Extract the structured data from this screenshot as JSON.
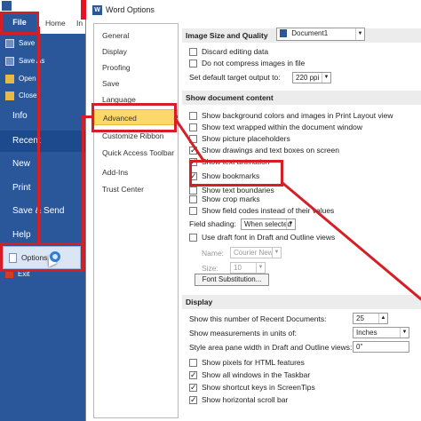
{
  "window": {
    "title": "Word Options"
  },
  "ribbon": {
    "file_tab": "File",
    "home_tab": "Home",
    "ins_tab": "In"
  },
  "backstage": {
    "save": "Save",
    "save_as": "Save As",
    "open": "Open",
    "close": "Close",
    "info": "Info",
    "recent": "Recent",
    "new": "New",
    "print": "Print",
    "save_send": "Save & Send",
    "help": "Help",
    "options": "Options",
    "exit": "Exit"
  },
  "nav": {
    "items": [
      "General",
      "Display",
      "Proofing",
      "Save",
      "Language",
      "Advanced",
      "Customize Ribbon",
      "Quick Access Toolbar",
      "Add-Ins",
      "Trust Center"
    ]
  },
  "image_quality": {
    "header": "Image Size and Quality",
    "document": "Document1",
    "discard_editing": "Discard editing data",
    "no_compress": "Do not compress images in file",
    "default_output_label": "Set default target output to:",
    "default_output_value": "220 ppi"
  },
  "show_doc": {
    "header": "Show document content",
    "items": [
      {
        "label": "Show background colors and images in Print Layout view",
        "checked": false
      },
      {
        "label": "Show text wrapped within the document window",
        "checked": false
      },
      {
        "label": "Show picture placeholders",
        "checked": false
      },
      {
        "label": "Show drawings and text boxes on screen",
        "checked": true
      },
      {
        "label": "Show text animation",
        "checked": true
      },
      {
        "label": "Show bookmarks",
        "checked": true
      },
      {
        "label": "Show text boundaries",
        "checked": false
      },
      {
        "label": "Show crop marks",
        "checked": false
      },
      {
        "label": "Show field codes instead of their values",
        "checked": false
      }
    ],
    "field_shading_label": "Field shading:",
    "field_shading_value": "When selected",
    "draft_font": "Use draft font in Draft and Outline views",
    "name_label": "Name:",
    "name_value": "Courier New",
    "size_label": "Size:",
    "size_value": "10",
    "font_sub_button": "Font Substitution..."
  },
  "display": {
    "header": "Display",
    "recent_docs_label": "Show this number of Recent Documents:",
    "recent_docs_value": "25",
    "units_label": "Show measurements in units of:",
    "units_value": "Inches",
    "style_width_label": "Style area pane width in Draft and Outline views:",
    "style_width_value": "0\"",
    "items": [
      {
        "label": "Show pixels for HTML features",
        "checked": false
      },
      {
        "label": "Show all windows in the Taskbar",
        "checked": true
      },
      {
        "label": "Show shortcut keys in ScreenTips",
        "checked": true
      },
      {
        "label": "Show horizontal scroll bar",
        "checked": true
      }
    ]
  }
}
